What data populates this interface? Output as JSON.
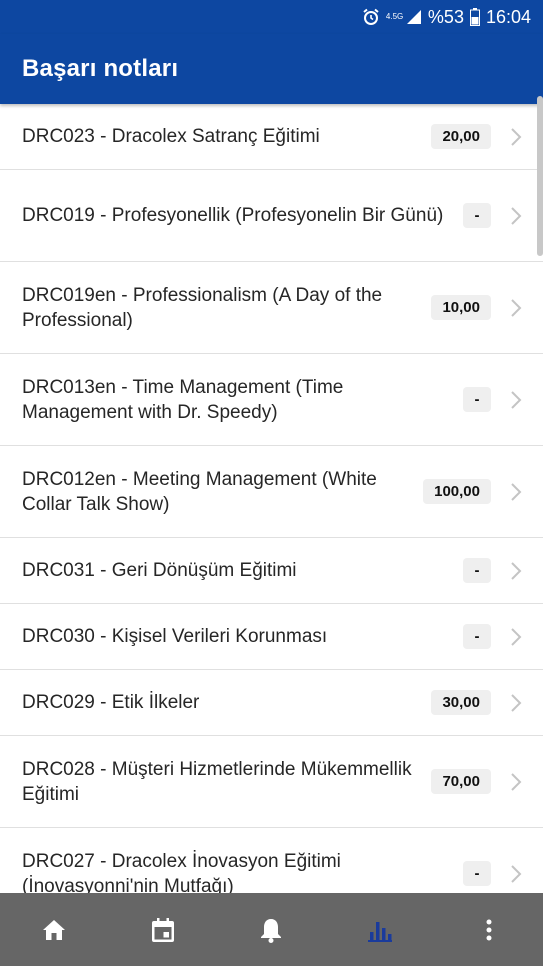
{
  "status": {
    "network": "4.5G",
    "battery": "%53",
    "time": "16:04"
  },
  "header": {
    "title": "Başarı notları"
  },
  "colors": {
    "appbar": "#0d47a1",
    "navbar": "#666666",
    "nav_active": "#1a3b9c",
    "nav_inactive": "#ffffff"
  },
  "list": {
    "items": [
      {
        "title": "DRC023 - Dracolex Satranç Eğitimi",
        "score": "20,00"
      },
      {
        "title": "DRC019 - Profesyonellik (Profesyonelin Bir Günü)",
        "score": "-"
      },
      {
        "title": "DRC019en - Professionalism (A Day of the Professional)",
        "score": "10,00"
      },
      {
        "title": "DRC013en - Time Management (Time Management with Dr. Speedy)",
        "score": "-"
      },
      {
        "title": "DRC012en - Meeting Management (White Collar Talk Show)",
        "score": "100,00"
      },
      {
        "title": "DRC031 - Geri Dönüşüm Eğitimi",
        "score": "-"
      },
      {
        "title": "DRC030 - Kişisel Verileri Korunması",
        "score": "-"
      },
      {
        "title": "DRC029 - Etik İlkeler",
        "score": "30,00"
      },
      {
        "title": "DRC028 - Müşteri Hizmetlerinde Mükemmellik Eğitimi",
        "score": "70,00"
      },
      {
        "title": "DRC027 - Dracolex İnovasyon Eğitimi (İnovasyonni'nin Mutfağı)",
        "score": "-"
      }
    ]
  },
  "navbar": {
    "items": [
      {
        "icon": "home-icon",
        "active": false
      },
      {
        "icon": "calendar-icon",
        "active": false
      },
      {
        "icon": "bell-icon",
        "active": false
      },
      {
        "icon": "bar-chart-icon",
        "active": true
      },
      {
        "icon": "more-vertical-icon",
        "active": false
      }
    ]
  }
}
